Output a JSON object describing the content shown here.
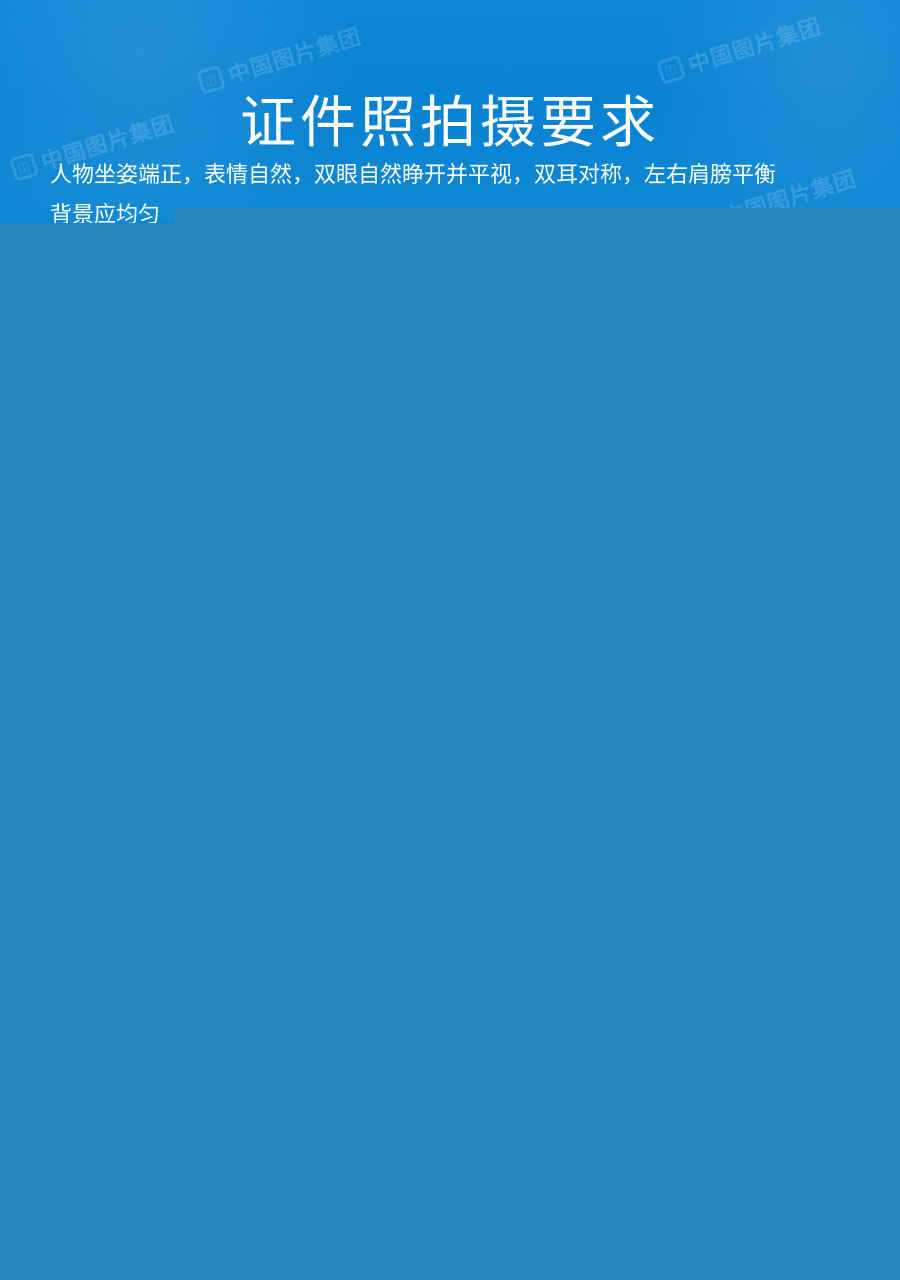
{
  "header": {
    "title": "证件照拍摄要求",
    "watermark": "中国图片集团"
  },
  "content": {
    "line_1": "人物坐姿端正，表情自然，双眼自然睁开并平视，双耳对称，左右肩膀平衡",
    "line_2": "背景应均匀"
  },
  "colors": {
    "header_blue": "#0c86d6",
    "panel_blue": "#2789be",
    "text": "#ffffff"
  }
}
